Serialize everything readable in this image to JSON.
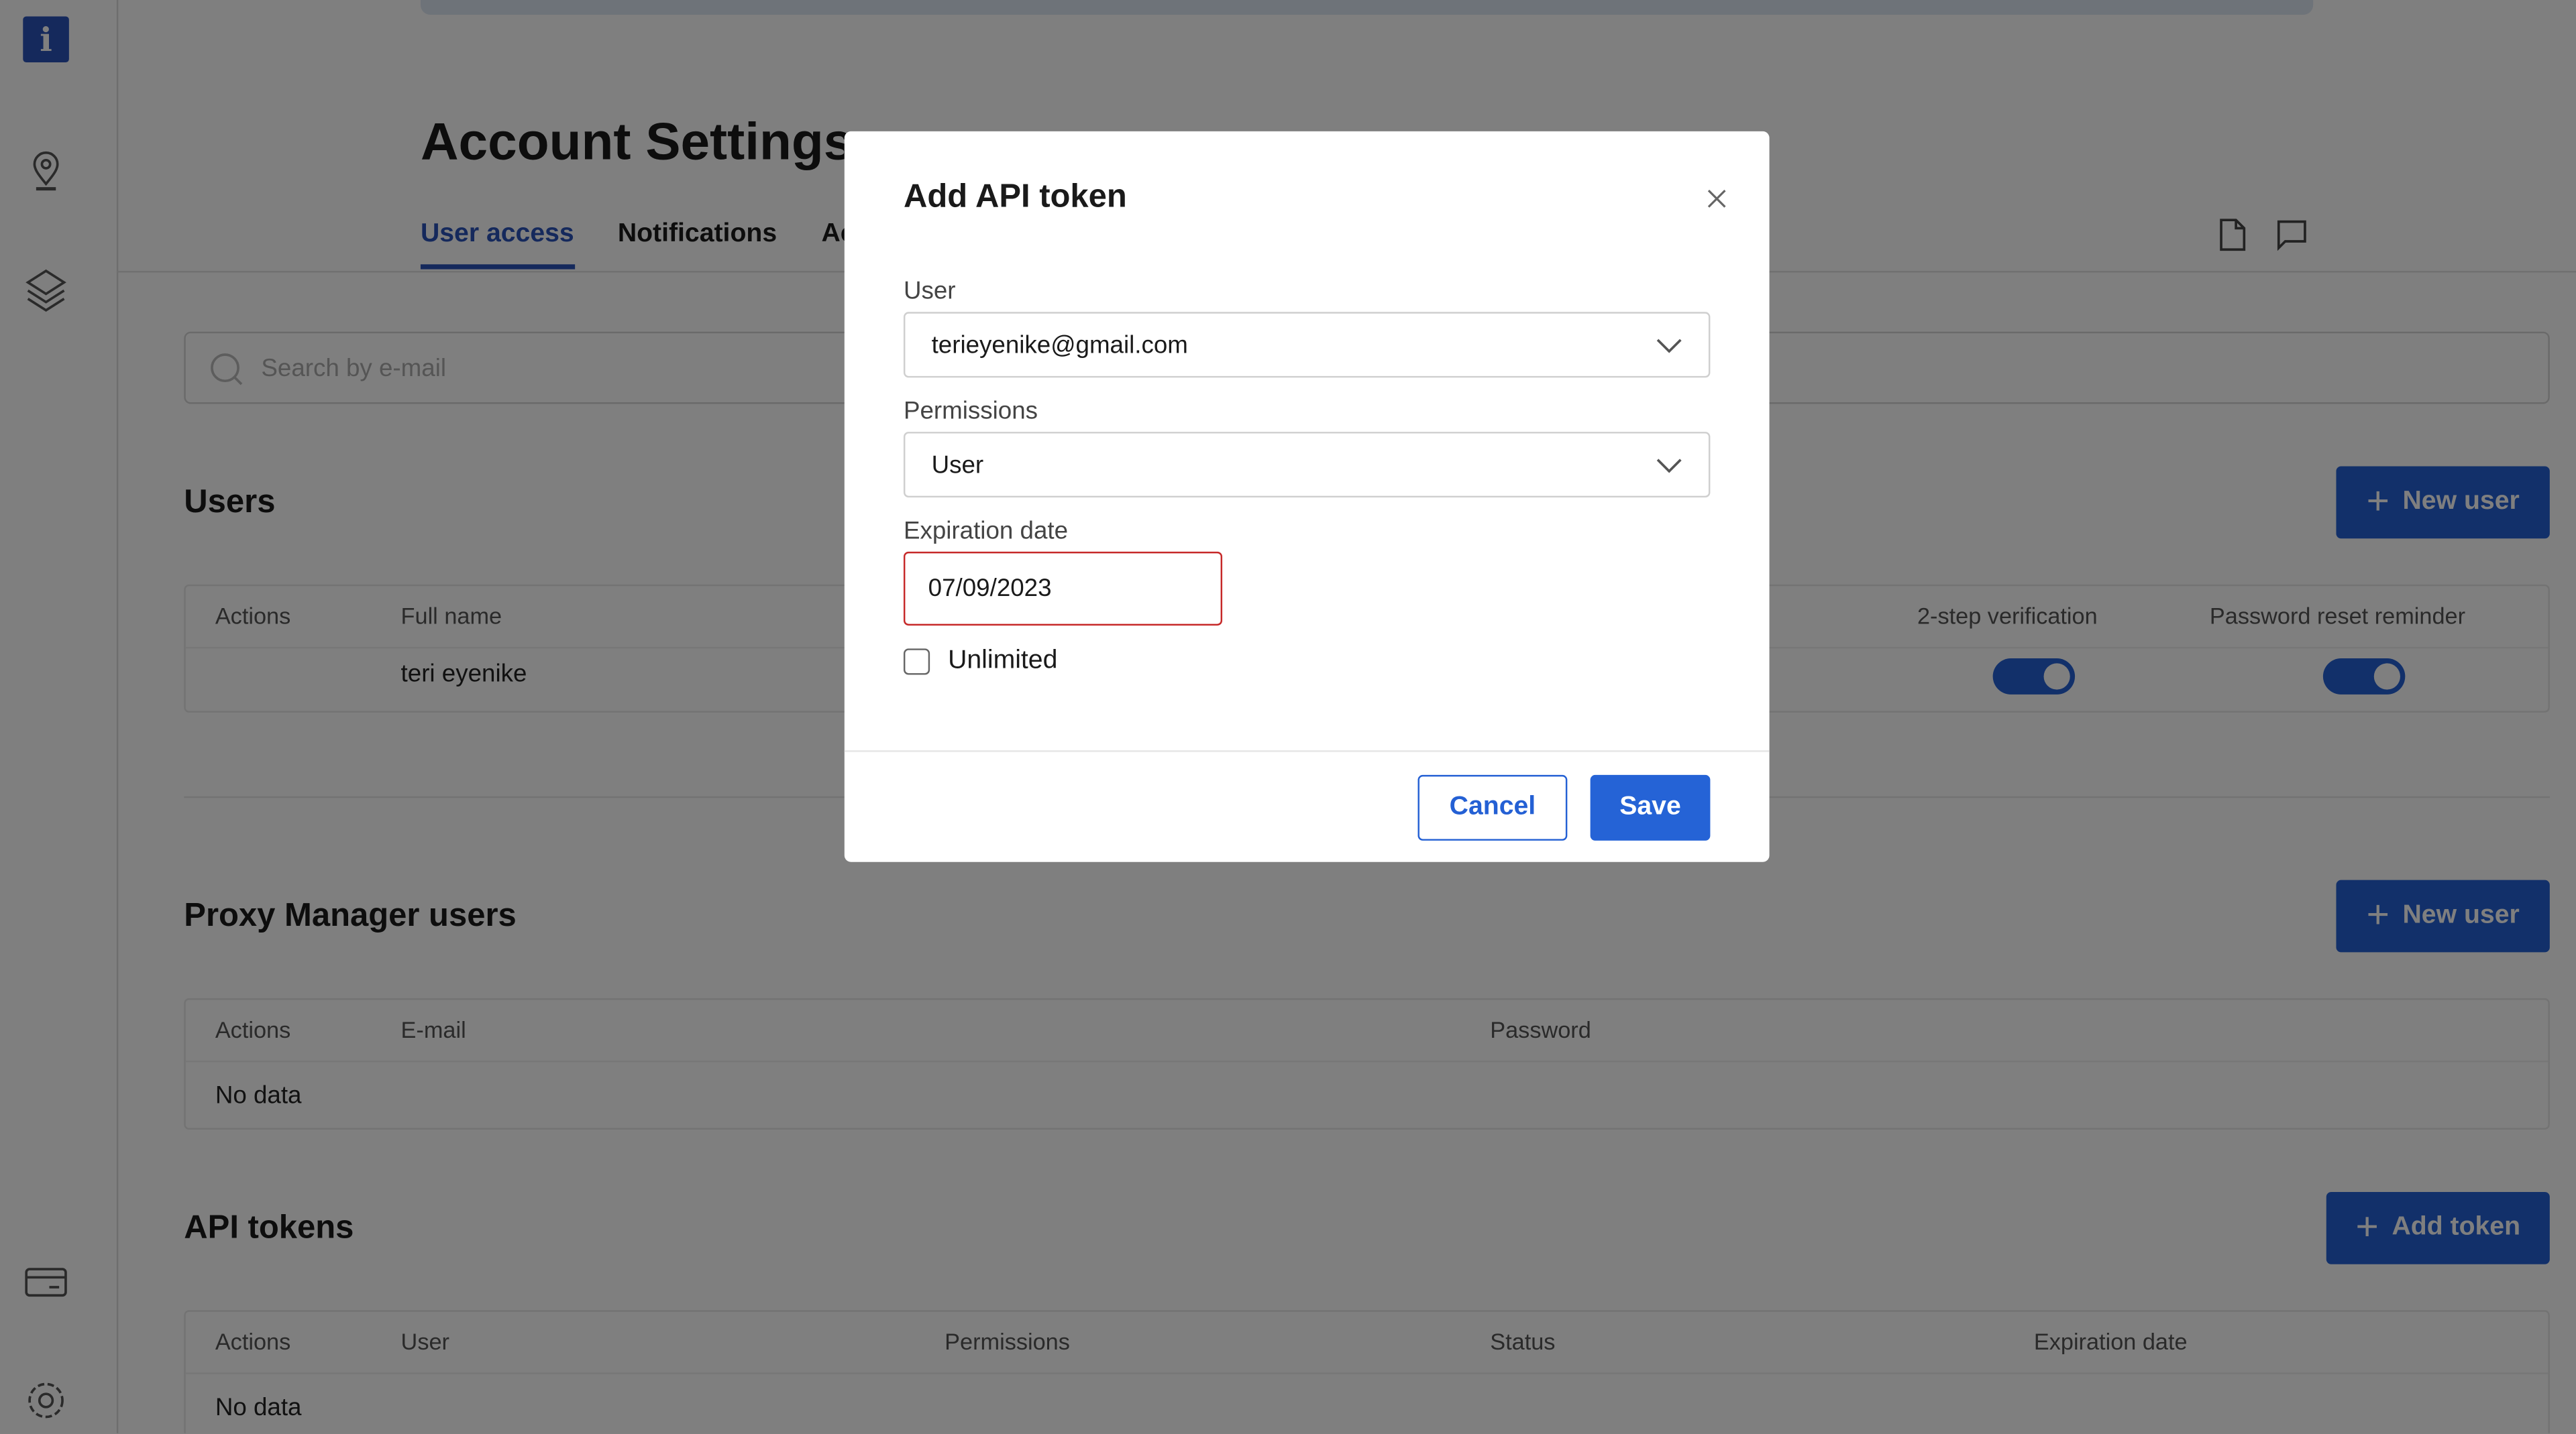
{
  "sidebar": {
    "icons": [
      "info-logo",
      "location-pin-icon",
      "layers-icon",
      "billing-card-icon",
      "settings-gear-icon"
    ]
  },
  "page": {
    "title": "Account Settings",
    "tabs": [
      {
        "label": "User access",
        "active": true
      },
      {
        "label": "Notifications"
      },
      {
        "label": "Ac"
      }
    ],
    "search_placeholder": "Search by e-mail"
  },
  "users": {
    "title": "Users",
    "new_button": "New user",
    "columns": [
      "Actions",
      "Full name",
      "2-step verification",
      "Password reset reminder"
    ],
    "rows": [
      {
        "full_name": "teri eyenike",
        "two_step": true,
        "reset_reminder": true
      }
    ]
  },
  "proxy": {
    "title": "Proxy Manager users",
    "new_button": "New user",
    "columns": [
      "Actions",
      "E-mail",
      "Password"
    ],
    "empty": "No data"
  },
  "tokens": {
    "title": "API tokens",
    "add_button": "Add token",
    "columns": [
      "Actions",
      "User",
      "Permissions",
      "Status",
      "Expiration date"
    ],
    "empty": "No data"
  },
  "modal": {
    "title": "Add API token",
    "user_label": "User",
    "user_value": "terieyenike@gmail.com",
    "permissions_label": "Permissions",
    "permissions_value": "User",
    "expiration_label": "Expiration date",
    "expiration_value": "07/09/2023",
    "unlimited_label": "Unlimited",
    "unlimited_checked": false,
    "cancel": "Cancel",
    "save": "Save"
  },
  "colors": {
    "accent": "#2460d4",
    "error_border": "#c62828"
  }
}
